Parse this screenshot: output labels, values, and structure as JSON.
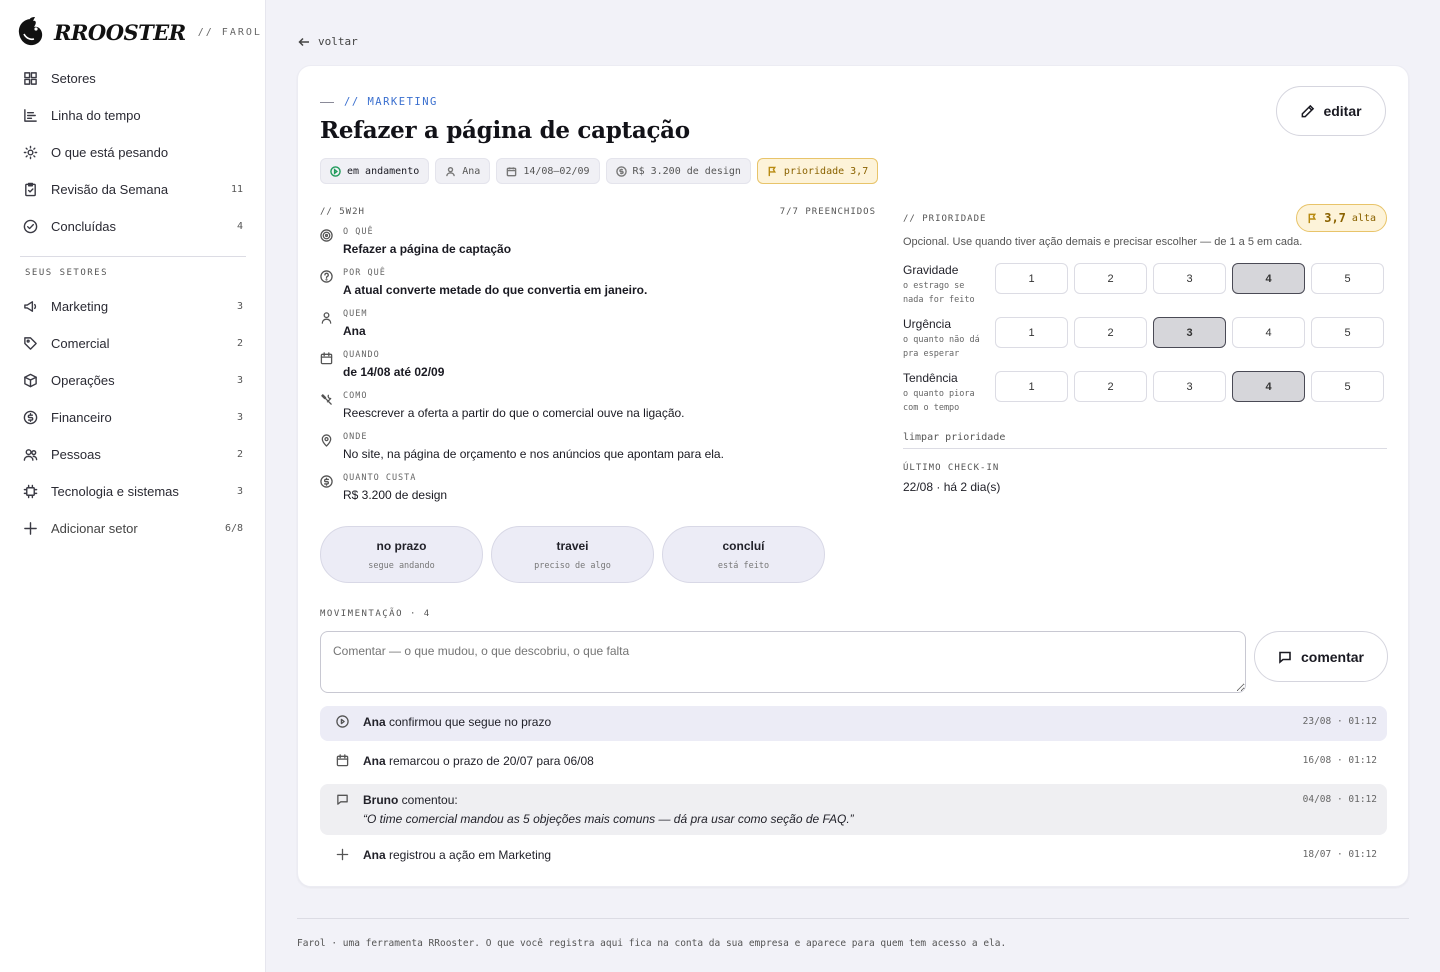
{
  "brand": {
    "name": "RROOSTER",
    "tag": "// FAROL"
  },
  "nav": {
    "main": [
      {
        "label": "Setores",
        "icon": "grid-icon",
        "count": ""
      },
      {
        "label": "Linha do tempo",
        "icon": "timeline-icon",
        "count": ""
      },
      {
        "label": "O que está pesando",
        "icon": "sun-icon",
        "count": ""
      },
      {
        "label": "Revisão da Semana",
        "icon": "clipboard-icon",
        "count": "11"
      },
      {
        "label": "Concluídas",
        "icon": "check-circle-icon",
        "count": "4"
      }
    ],
    "section_label": "SEUS SETORES",
    "sectors": [
      {
        "label": "Marketing",
        "icon": "megaphone-icon",
        "count": "3"
      },
      {
        "label": "Comercial",
        "icon": "tag-icon",
        "count": "2"
      },
      {
        "label": "Operações",
        "icon": "box-icon",
        "count": "3"
      },
      {
        "label": "Financeiro",
        "icon": "dollar-icon",
        "count": "3"
      },
      {
        "label": "Pessoas",
        "icon": "users-icon",
        "count": "2"
      },
      {
        "label": "Tecnologia e sistemas",
        "icon": "chip-icon",
        "count": "3"
      },
      {
        "label": "Adicionar setor",
        "icon": "plus-icon",
        "count": "6/8"
      }
    ]
  },
  "back_label": "voltar",
  "action": {
    "kicker": "// MARKETING",
    "title": "Refazer a página de captação",
    "edit_label": "editar",
    "chips": {
      "status": "em andamento",
      "owner": "Ana",
      "dates": "14/08–02/09",
      "cost": "R$ 3.200 de design",
      "priority": "prioridade 3,7"
    }
  },
  "w5h2": {
    "label": "// 5W2H",
    "filled": "7/7 PREENCHIDOS",
    "items": [
      {
        "label": "O QUÊ",
        "value": "Refazer a página de captação",
        "icon": "target-icon"
      },
      {
        "label": "POR QUÊ",
        "value": "A atual converte metade do que convertia em janeiro.",
        "icon": "question-icon"
      },
      {
        "label": "QUEM",
        "value": "Ana",
        "icon": "person-icon"
      },
      {
        "label": "QUANDO",
        "value": "de 14/08 até 02/09",
        "icon": "calendar-icon"
      },
      {
        "label": "COMO",
        "value": "Reescrever a oferta a partir do que o comercial ouve na ligação.",
        "icon": "tools-icon"
      },
      {
        "label": "ONDE",
        "value": "No site, na página de orçamento e nos anúncios que apontam para ela.",
        "icon": "pin-icon"
      },
      {
        "label": "QUANTO CUSTA",
        "value": "R$ 3.200 de design",
        "icon": "dollar-icon"
      }
    ]
  },
  "status_buttons": [
    {
      "title": "no prazo",
      "sub": "segue andando"
    },
    {
      "title": "travei",
      "sub": "preciso de algo"
    },
    {
      "title": "concluí",
      "sub": "está feito"
    }
  ],
  "priority": {
    "label": "// PRIORIDADE",
    "score": "3,7",
    "level": "alta",
    "description": "Opcional. Use quando tiver ação demais e precisar escolher — de 1 a 5 em cada.",
    "options": [
      "1",
      "2",
      "3",
      "4",
      "5"
    ],
    "scales": [
      {
        "name": "Gravidade",
        "sub": "o estrago se nada for feito",
        "selected": 4
      },
      {
        "name": "Urgência",
        "sub": "o quanto não dá pra esperar",
        "selected": 3
      },
      {
        "name": "Tendência",
        "sub": "o quanto piora com o tempo",
        "selected": 4
      }
    ],
    "clear_label": "limpar prioridade",
    "checkin_label": "ÚLTIMO CHECK-IN",
    "checkin_value": "22/08 · há 2 dia(s)"
  },
  "movement": {
    "label": "MOVIMENTAÇÃO · 4",
    "comment_placeholder": "Comentar — o que mudou, o que descobriu, o que falta",
    "comment_button": "comentar",
    "feed": [
      {
        "actor": "Ana",
        "text": " confirmou que segue no prazo",
        "quote": "",
        "time": "23/08 · 01:12",
        "icon": "play-circle-icon",
        "style": "hl"
      },
      {
        "actor": "Ana",
        "text": " remarcou o prazo de 20/07 para 06/08",
        "quote": "",
        "time": "16/08 · 01:12",
        "icon": "calendar-icon",
        "style": ""
      },
      {
        "actor": "Bruno",
        "text": " comentou:",
        "quote": "“O time comercial mandou as 5 objeções mais comuns — dá pra usar como seção de FAQ.”",
        "time": "04/08 · 01:12",
        "icon": "comment-icon",
        "style": "gray"
      },
      {
        "actor": "Ana",
        "text": " registrou a ação em Marketing",
        "quote": "",
        "time": "18/07 · 01:12",
        "icon": "plus-icon",
        "style": ""
      }
    ]
  },
  "footer": "Farol · uma ferramenta RRooster. O que você registra aqui fica na conta da sua empresa e aparece para quem tem acesso a ela."
}
